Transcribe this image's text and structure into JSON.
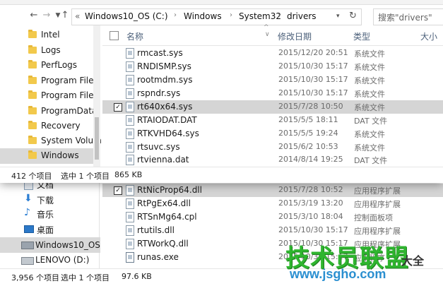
{
  "address": {
    "root_chevron": "«",
    "crumbs": [
      "Windows10_OS (C:)",
      "Windows",
      "System32",
      "drivers"
    ],
    "search_placeholder": "搜索\"drivers\""
  },
  "nav_pane": {
    "items": [
      {
        "label": "Intel"
      },
      {
        "label": "Logs"
      },
      {
        "label": "PerfLogs"
      },
      {
        "label": "Program Files"
      },
      {
        "label": "Program Files"
      },
      {
        "label": "ProgramData"
      },
      {
        "label": "Recovery"
      },
      {
        "label": "System Volum"
      },
      {
        "label": "Windows",
        "selected": true
      }
    ]
  },
  "columns": {
    "name": "名称",
    "date": "修改日期",
    "type": "类型",
    "size": "大小"
  },
  "files_front": [
    {
      "name": "rmcast.sys",
      "date": "2015/12/20 20:51",
      "type": "系统文件"
    },
    {
      "name": "RNDISMP.sys",
      "date": "2015/10/30 15:17",
      "type": "系统文件"
    },
    {
      "name": "rootmdm.sys",
      "date": "2015/10/30 15:17",
      "type": "系统文件"
    },
    {
      "name": "rspndr.sys",
      "date": "2015/10/30 15:17",
      "type": "系统文件"
    },
    {
      "name": "rt640x64.sys",
      "date": "2015/7/28 10:50",
      "type": "系统文件",
      "selected": true
    },
    {
      "name": "RTAIODAT.DAT",
      "date": "2015/5/5 18:11",
      "type": "DAT 文件"
    },
    {
      "name": "RTKVHD64.sys",
      "date": "2015/5/5 19:24",
      "type": "系统文件"
    },
    {
      "name": "rtsuvc.sys",
      "date": "2015/6/2 10:53",
      "type": "系统文件"
    },
    {
      "name": "rtvienna.dat",
      "date": "2014/8/14 19:25",
      "type": "DAT 文件"
    }
  ],
  "status_front": {
    "count": "412 个项目",
    "selected": "选中 1 个项目",
    "size": "865 KB"
  },
  "back_nav": [
    {
      "label": "文档"
    },
    {
      "label": "下载"
    },
    {
      "label": "音乐"
    },
    {
      "label": "桌面"
    },
    {
      "label": "Windows10_OS",
      "selected": true
    },
    {
      "label": "LENOVO (D:)"
    }
  ],
  "files_back": [
    {
      "name": "RtNicProp64.dll",
      "date": "2015/7/28 10:52",
      "type": "应用程序扩展",
      "selected": true
    },
    {
      "name": "RtPgEx64.dll",
      "date": "2015/3/19 13:20",
      "type": "应用程序扩展"
    },
    {
      "name": "RTSnMg64.cpl",
      "date": "2015/3/10 18:04",
      "type": "控制面板项"
    },
    {
      "name": "rtutils.dll",
      "date": "2015/10/30 15:17",
      "type": "应用程序扩展"
    },
    {
      "name": "RTWorkQ.dll",
      "date": "2015/10/30 15:17",
      "type": "应用程序扩展"
    },
    {
      "name": "runas.exe",
      "date": "2015/10/30 15:17",
      "type": "应用程序"
    }
  ],
  "status_back": {
    "count": "3,956 个项目",
    "selected": "选中 1 个项目",
    "size": "97.6 KB"
  },
  "watermark": {
    "main": "技术员联盟",
    "suffix": "大全",
    "url": "www.jsgho.com"
  }
}
